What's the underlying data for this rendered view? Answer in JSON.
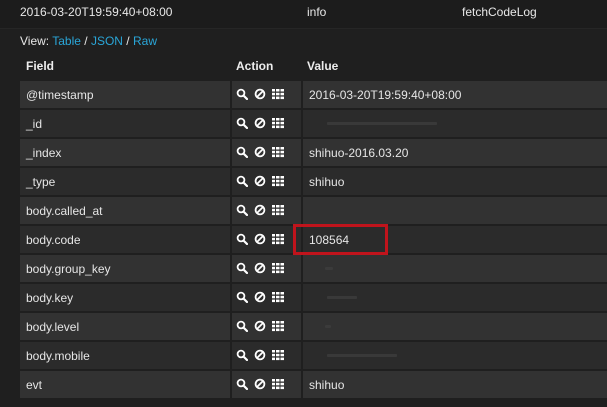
{
  "summary": {
    "timestamp": "2016-03-20T19:59:40+08:00",
    "level": "info",
    "source": "fetchCodeLog"
  },
  "view": {
    "prefix": "View: ",
    "options": [
      "Table",
      "JSON",
      "Raw"
    ],
    "separator": " / "
  },
  "columns": {
    "field": "Field",
    "action": "Action",
    "value": "Value"
  },
  "rows": [
    {
      "field": "@timestamp",
      "value": "2016-03-20T19:59:40+08:00"
    },
    {
      "field": "_id",
      "value": ""
    },
    {
      "field": "_index",
      "value": "shihuo-2016.03.20"
    },
    {
      "field": "_type",
      "value": "shihuo"
    },
    {
      "field": "body.called_at",
      "value": ""
    },
    {
      "field": "body.code",
      "value": "108564"
    },
    {
      "field": "body.group_key",
      "value": ""
    },
    {
      "field": "body.key",
      "value": ""
    },
    {
      "field": "body.level",
      "value": ""
    },
    {
      "field": "body.mobile",
      "value": ""
    },
    {
      "field": "evt",
      "value": "shihuo"
    }
  ],
  "icons": {
    "filter_for": "magnifier-icon",
    "filter_out": "circle-slash-icon",
    "toggle_column": "grid-icon"
  },
  "colors": {
    "link": "#2aa6d8",
    "highlight": "#c0141c"
  }
}
